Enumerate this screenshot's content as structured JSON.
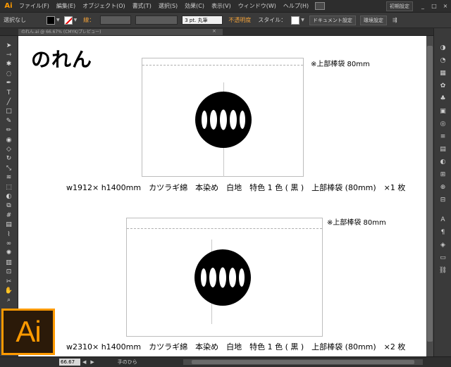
{
  "menubar": {
    "app_icon": "Ai",
    "items": [
      "ファイル(F)",
      "編集(E)",
      "オブジェクト(O)",
      "書式(T)",
      "選択(S)",
      "効果(C)",
      "表示(V)",
      "ウィンドウ(W)",
      "ヘルプ(H)"
    ],
    "workspace": "初期設定",
    "window_controls": [
      "_",
      "□",
      "×"
    ]
  },
  "controlbar": {
    "selection": "選択なし",
    "stroke_label": "線：",
    "brush": "3 pt. 丸筆",
    "opacity_label": "不透明度",
    "style_label": "スタイル：",
    "doc_settings": "ドキュメント設定",
    "preferences": "環境設定"
  },
  "doctab": {
    "title": "のれん.ai @ 66.67% (CMYK/プレビュー)",
    "close": "×"
  },
  "canvas": {
    "title": "のれん",
    "noren1": {
      "note": "※上部棒袋 80mm",
      "spec": "w1912× h1400mm　カツラギ綿　本染め　白地　特色 1 色 ( 黒 )　上部棒袋 (80mm)　×1 枚"
    },
    "noren2": {
      "note": "※上部棒袋 80mm",
      "spec": "w2310× h1400mm　カツラギ綿　本染め　白地　特色 1 色 ( 黒 )　上部棒袋 (80mm)　×2 枚"
    }
  },
  "statusbar": {
    "zoom": "66.67",
    "current_tool": "手のひら"
  },
  "logo_text": "Ai",
  "colors": {
    "accent": "#ff9a00",
    "crest": "#000000"
  },
  "tools": [
    "selection-icon",
    "direct-selection-icon",
    "magic-wand-icon",
    "lasso-icon",
    "pen-icon",
    "type-icon",
    "line-icon",
    "rectangle-icon",
    "paintbrush-icon",
    "pencil-icon",
    "blob-brush-icon",
    "eraser-icon",
    "rotate-icon",
    "scale-icon",
    "width-icon",
    "free-transform-icon",
    "shape-builder-icon",
    "perspective-icon",
    "mesh-icon",
    "gradient-icon",
    "eyedropper-icon",
    "blend-icon",
    "symbol-sprayer-icon",
    "graph-icon",
    "artboard-icon",
    "slice-icon",
    "hand-icon",
    "zoom-icon"
  ],
  "panels": [
    "color-panel-icon",
    "color-guide-icon",
    "swatches-icon",
    "brushes-icon",
    "symbols-icon",
    "graphic-styles-icon",
    "appearance-icon",
    "stroke-icon",
    "gradient-panel-icon",
    "transparency-icon",
    "align-icon",
    "transform-icon",
    "pathfinder-icon",
    "character-icon",
    "paragraph-icon",
    "layers-icon",
    "artboards-icon",
    "links-icon"
  ]
}
